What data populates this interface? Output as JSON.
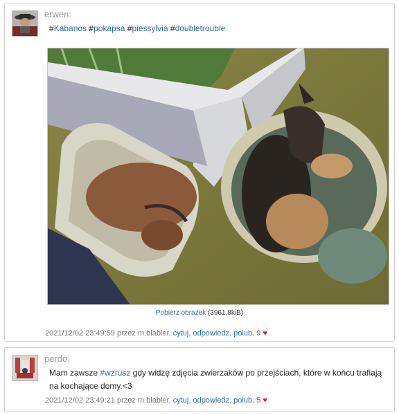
{
  "posts": [
    {
      "author": "erwen:",
      "hashtags": [
        "Kabanos",
        "pokapsa",
        "piessylvia",
        "doubletrouble"
      ],
      "hash_symbol": "#",
      "image": {
        "download_label": "Pobierz obrazek",
        "size": "(3961.8kiB)"
      },
      "meta": {
        "timestamp": "2021/12/02 23:49:59 przez m.blabler,",
        "quote": "cytuj",
        "reply": "odpowiedz",
        "like": "polub",
        "likes": "9"
      }
    },
    {
      "author": "perdo:",
      "text_prefix": "Mam zawsze ",
      "hashtag": "#wzrusz",
      "text_suffix": " gdy widzę zdjęcia zwierzaków po przejściach, które w końcu trafiają na kochające domy.<3",
      "meta": {
        "timestamp": "2021/12/02 23:49:21 przez m.blabler,",
        "quote": "cytuj",
        "reply": "odpowiedz",
        "like": "polub",
        "likes": "5"
      }
    }
  ],
  "icons": {
    "heart": "heart-icon"
  },
  "colors": {
    "link": "#2a6db5",
    "heart": "#e0202c",
    "author": "#9a9a9a"
  }
}
